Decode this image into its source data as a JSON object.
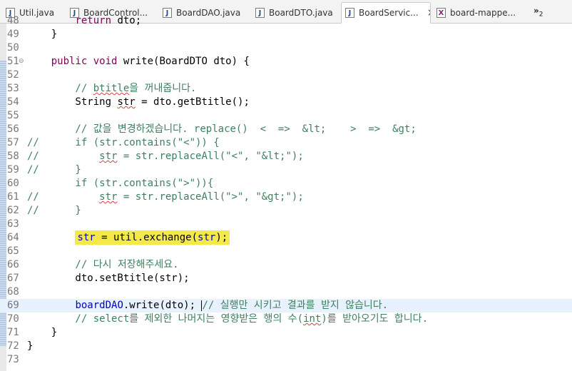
{
  "tabs": [
    {
      "label": "Util.java",
      "icon": "java-file-icon",
      "active": false
    },
    {
      "label": "BoardControl...",
      "icon": "java-file-icon",
      "active": false
    },
    {
      "label": "BoardDAO.java",
      "icon": "java-file-icon",
      "active": false
    },
    {
      "label": "BoardDTO.java",
      "icon": "java-file-icon",
      "active": false
    },
    {
      "label": "BoardServic...",
      "icon": "java-file-icon",
      "active": true
    },
    {
      "label": "board-mappe...",
      "icon": "xml-file-icon",
      "active": false
    }
  ],
  "overflow": {
    "glyph": "»",
    "count": "2"
  },
  "editor": {
    "lines": [
      {
        "n": "48",
        "text": "        return dto;"
      },
      {
        "n": "49",
        "text": "    }"
      },
      {
        "n": "50",
        "text": ""
      },
      {
        "n": "51",
        "text": "    public void write(BoardDTO dto) {"
      },
      {
        "n": "52",
        "text": ""
      },
      {
        "n": "53",
        "text": "        // btitle을 꺼내줍니다."
      },
      {
        "n": "54",
        "text": "        String str = dto.getBtitle();"
      },
      {
        "n": "55",
        "text": ""
      },
      {
        "n": "56",
        "text": "        // 값을 변경하겠습니다. replace()  <  =>  &lt;    >  =>  &gt;"
      },
      {
        "n": "57",
        "text": "//      if (str.contains(\"<\")) {"
      },
      {
        "n": "58",
        "text": "//          str = str.replaceAll(\"<\", \"&lt;\");"
      },
      {
        "n": "59",
        "text": "//      }"
      },
      {
        "n": "60",
        "text": "        if (str.contains(\">\")){"
      },
      {
        "n": "61",
        "text": "//          str = str.replaceAll(\">\", \"&gt;\");"
      },
      {
        "n": "62",
        "text": "//      }"
      },
      {
        "n": "63",
        "text": ""
      },
      {
        "n": "64",
        "text": "        str = util.exchange(str);"
      },
      {
        "n": "65",
        "text": ""
      },
      {
        "n": "66",
        "text": "        // 다시 저장해주세요."
      },
      {
        "n": "67",
        "text": "        dto.setBtitle(str);"
      },
      {
        "n": "68",
        "text": ""
      },
      {
        "n": "69",
        "text": "        boardDAO.write(dto); // 실행만 시키고 결과를 받지 않습니다."
      },
      {
        "n": "70",
        "text": "        // select를 제외한 나머지는 영향받은 행의 수(int)를 받아오기도 합니다."
      },
      {
        "n": "71",
        "text": "    }"
      },
      {
        "n": "72",
        "text": "}"
      },
      {
        "n": "73",
        "text": ""
      }
    ]
  }
}
